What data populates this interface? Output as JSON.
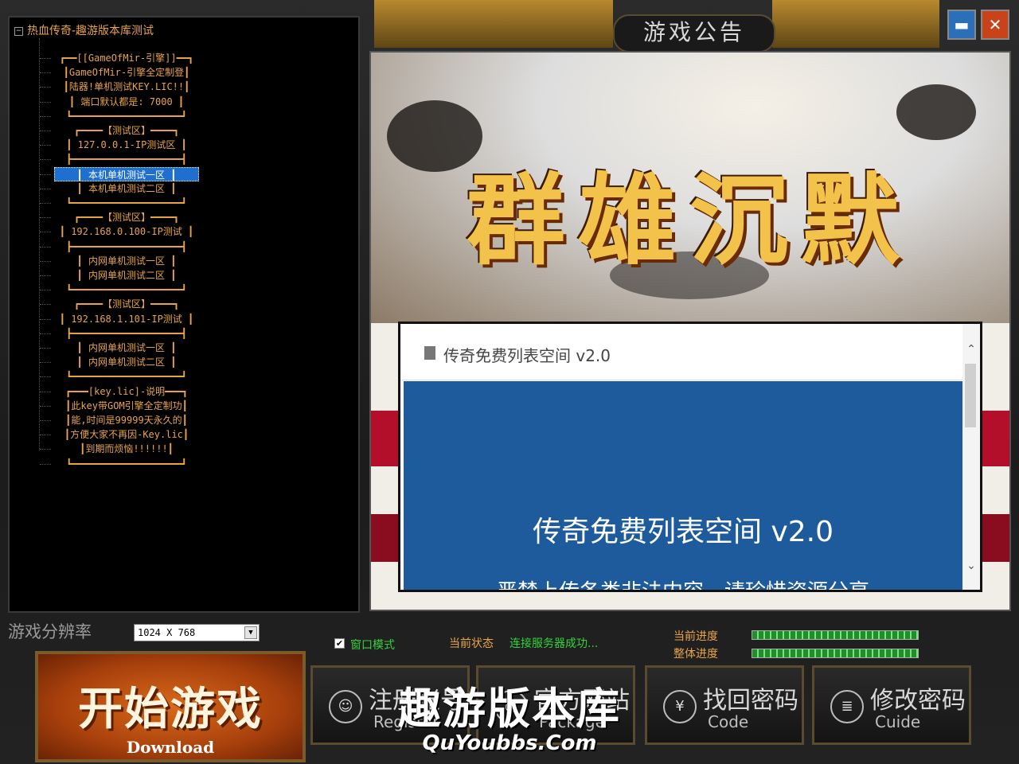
{
  "window": {
    "title": "游戏公告",
    "minimize_label": "▬",
    "close_label": "✕"
  },
  "server_tree": {
    "root": "热血传奇-趣游版本库测试",
    "collapse_glyph": "−",
    "nodes": [
      "┏━━[[GameOfMir-引擎]]━━┓",
      "┃GameOfMir-引擎全定制登┃",
      "┃陆器!单机测试KEY.LIC!!┃",
      "┃ 端口默认都是: 7000 ┃",
      "┗━━━━━━━━━━━━━━━━━━━┛",
      "┏━━━━【测试区】━━━━┓",
      "┃ 127.0.0.1-IP测试区 ┃",
      "┣━━━━━━━━━━━━━━━━━━━┫",
      "┃ 本机单机测试一区 ┃",
      "┃ 本机单机测试二区 ┃",
      "┗━━━━━━━━━━━━━━━━━━━┛",
      "┏━━━━【测试区】━━━━┓",
      "┃ 192.168.0.100-IP测试 ┃",
      "┣━━━━━━━━━━━━━━━━━━━┫",
      "┃ 内网单机测试一区 ┃",
      "┃ 内网单机测试二区 ┃",
      "┗━━━━━━━━━━━━━━━━━━━┛",
      "┏━━━━【测试区】━━━━┓",
      "┃ 192.168.1.101-IP测试 ┃",
      "┣━━━━━━━━━━━━━━━━━━━┫",
      "┃ 内网单机测试一区 ┃",
      "┃ 内网单机测试二区 ┃",
      "┗━━━━━━━━━━━━━━━━━━━┛",
      "┏━━━[key.lic]-说明━━━┓",
      "┃此key带GOM引擎全定制功┃",
      "┃能,时间是99999天永久的┃",
      "┃方便大家不再因-Key.lic┃",
      "┃到期而烦恼!!!!!!┃",
      "┗━━━━━━━━━━━━━━━━━━━┛"
    ],
    "selected_label": "本机单机测试一区"
  },
  "resolution": {
    "label": "游戏分辨率",
    "value": "1024 X 768"
  },
  "window_mode": {
    "label": "窗口模式",
    "checked_glyph": "✔"
  },
  "status": {
    "label": "当前状态",
    "value": "连接服务器成功..."
  },
  "progress": {
    "current_label": "当前进度",
    "overall_label": "整体进度",
    "current_fraction": 1.0,
    "overall_fraction": 1.0
  },
  "buttons": {
    "start_cn": "开始游戏",
    "start_en": "Download",
    "register_cn": "注册账号",
    "register_en": "Register",
    "website_cn": "官方网站",
    "website_en": "Package",
    "recover_cn": "找回密码",
    "recover_en": "Code",
    "recover_icon_glyph": "¥",
    "change_cn": "修改密码",
    "change_en": "Cuide",
    "change_icon_glyph": "≣",
    "register_icon_glyph": "☺",
    "website_icon_glyph": "◎"
  },
  "announcement": {
    "banner_title": "群雄沉默",
    "dialog_title": "传奇免费列表空间 v2.0",
    "dialog_main": "传奇免费列表空间 v2.0",
    "dialog_sub": "严禁上传各类非法内容，请珍惜资源分享",
    "scroll_up": "⌃",
    "scroll_down": "⌄"
  },
  "watermark": {
    "cn": "趣游版本库",
    "en": "QuYoubbs.Com"
  },
  "colors": {
    "tree_text": "#e8a448",
    "status_green": "#32d23a",
    "selected_bg": "#1e6fd0",
    "dialog_blue": "#1d5b9d"
  }
}
